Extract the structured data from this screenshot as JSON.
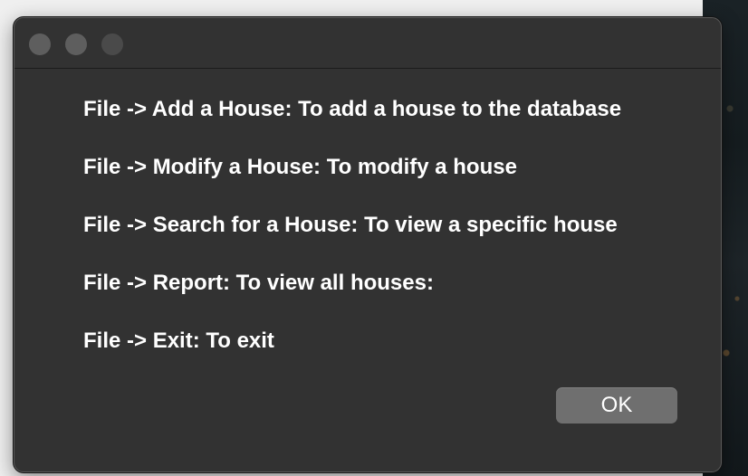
{
  "dialog": {
    "lines": [
      "File -> Add a House: To add a house to the database",
      "File -> Modify a House: To modify a house",
      "File -> Search for a House: To view a specific house",
      "File -> Report: To view all houses:",
      "File -> Exit: To exit"
    ],
    "ok_label": "OK"
  },
  "window_controls": {
    "icons": [
      "close-icon",
      "minimize-icon",
      "zoom-icon"
    ]
  },
  "colors": {
    "window_background": "#323232",
    "text": "#ffffff",
    "button": "#6f6f6f"
  }
}
